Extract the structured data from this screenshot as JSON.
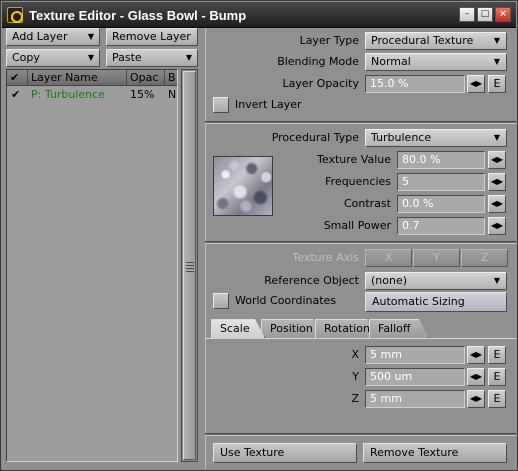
{
  "window": {
    "title": "Texture Editor - Glass Bowl - Bump",
    "controls": {
      "minimize": "–",
      "maximize": "□",
      "close": "×"
    }
  },
  "toolbar": {
    "add_layer": "Add Layer",
    "remove_layer": "Remove Layer",
    "copy": "Copy",
    "paste": "Paste"
  },
  "layer_list": {
    "columns": [
      "✔",
      "Layer Name",
      "Opac",
      "B"
    ],
    "rows": [
      {
        "check": "✔",
        "name": "P: Turbulence",
        "opacity": "15%",
        "blend": "N"
      }
    ]
  },
  "layer": {
    "type_label": "Layer Type",
    "type_value": "Procedural Texture",
    "blending_label": "Blending Mode",
    "blending_value": "Normal",
    "opacity_label": "Layer Opacity",
    "opacity_value": "15.0 %",
    "invert_label": "Invert Layer"
  },
  "procedural": {
    "type_label": "Procedural Type",
    "type_value": "Turbulence",
    "params": [
      {
        "label": "Texture Value",
        "value": "80.0 %"
      },
      {
        "label": "Frequencies",
        "value": "5"
      },
      {
        "label": "Contrast",
        "value": "0.0 %"
      },
      {
        "label": "Small Power",
        "value": "0.7"
      }
    ]
  },
  "mapping": {
    "axis_label": "Texture Axis",
    "axis_x": "X",
    "axis_y": "Y",
    "axis_z": "Z",
    "reference_label": "Reference Object",
    "reference_value": "(none)",
    "world_coords_label": "World Coordinates",
    "auto_sizing": "Automatic Sizing"
  },
  "tabs": [
    "Scale",
    "Position",
    "Rotation",
    "Falloff"
  ],
  "scale": [
    {
      "axis": "X",
      "value": "5 mm"
    },
    {
      "axis": "Y",
      "value": "500 um"
    },
    {
      "axis": "Z",
      "value": "5 mm"
    }
  ],
  "footer": {
    "use_texture": "Use Texture",
    "remove_texture": "Remove Texture"
  },
  "icons": {
    "slider": "◀▶",
    "envelope": "E"
  }
}
